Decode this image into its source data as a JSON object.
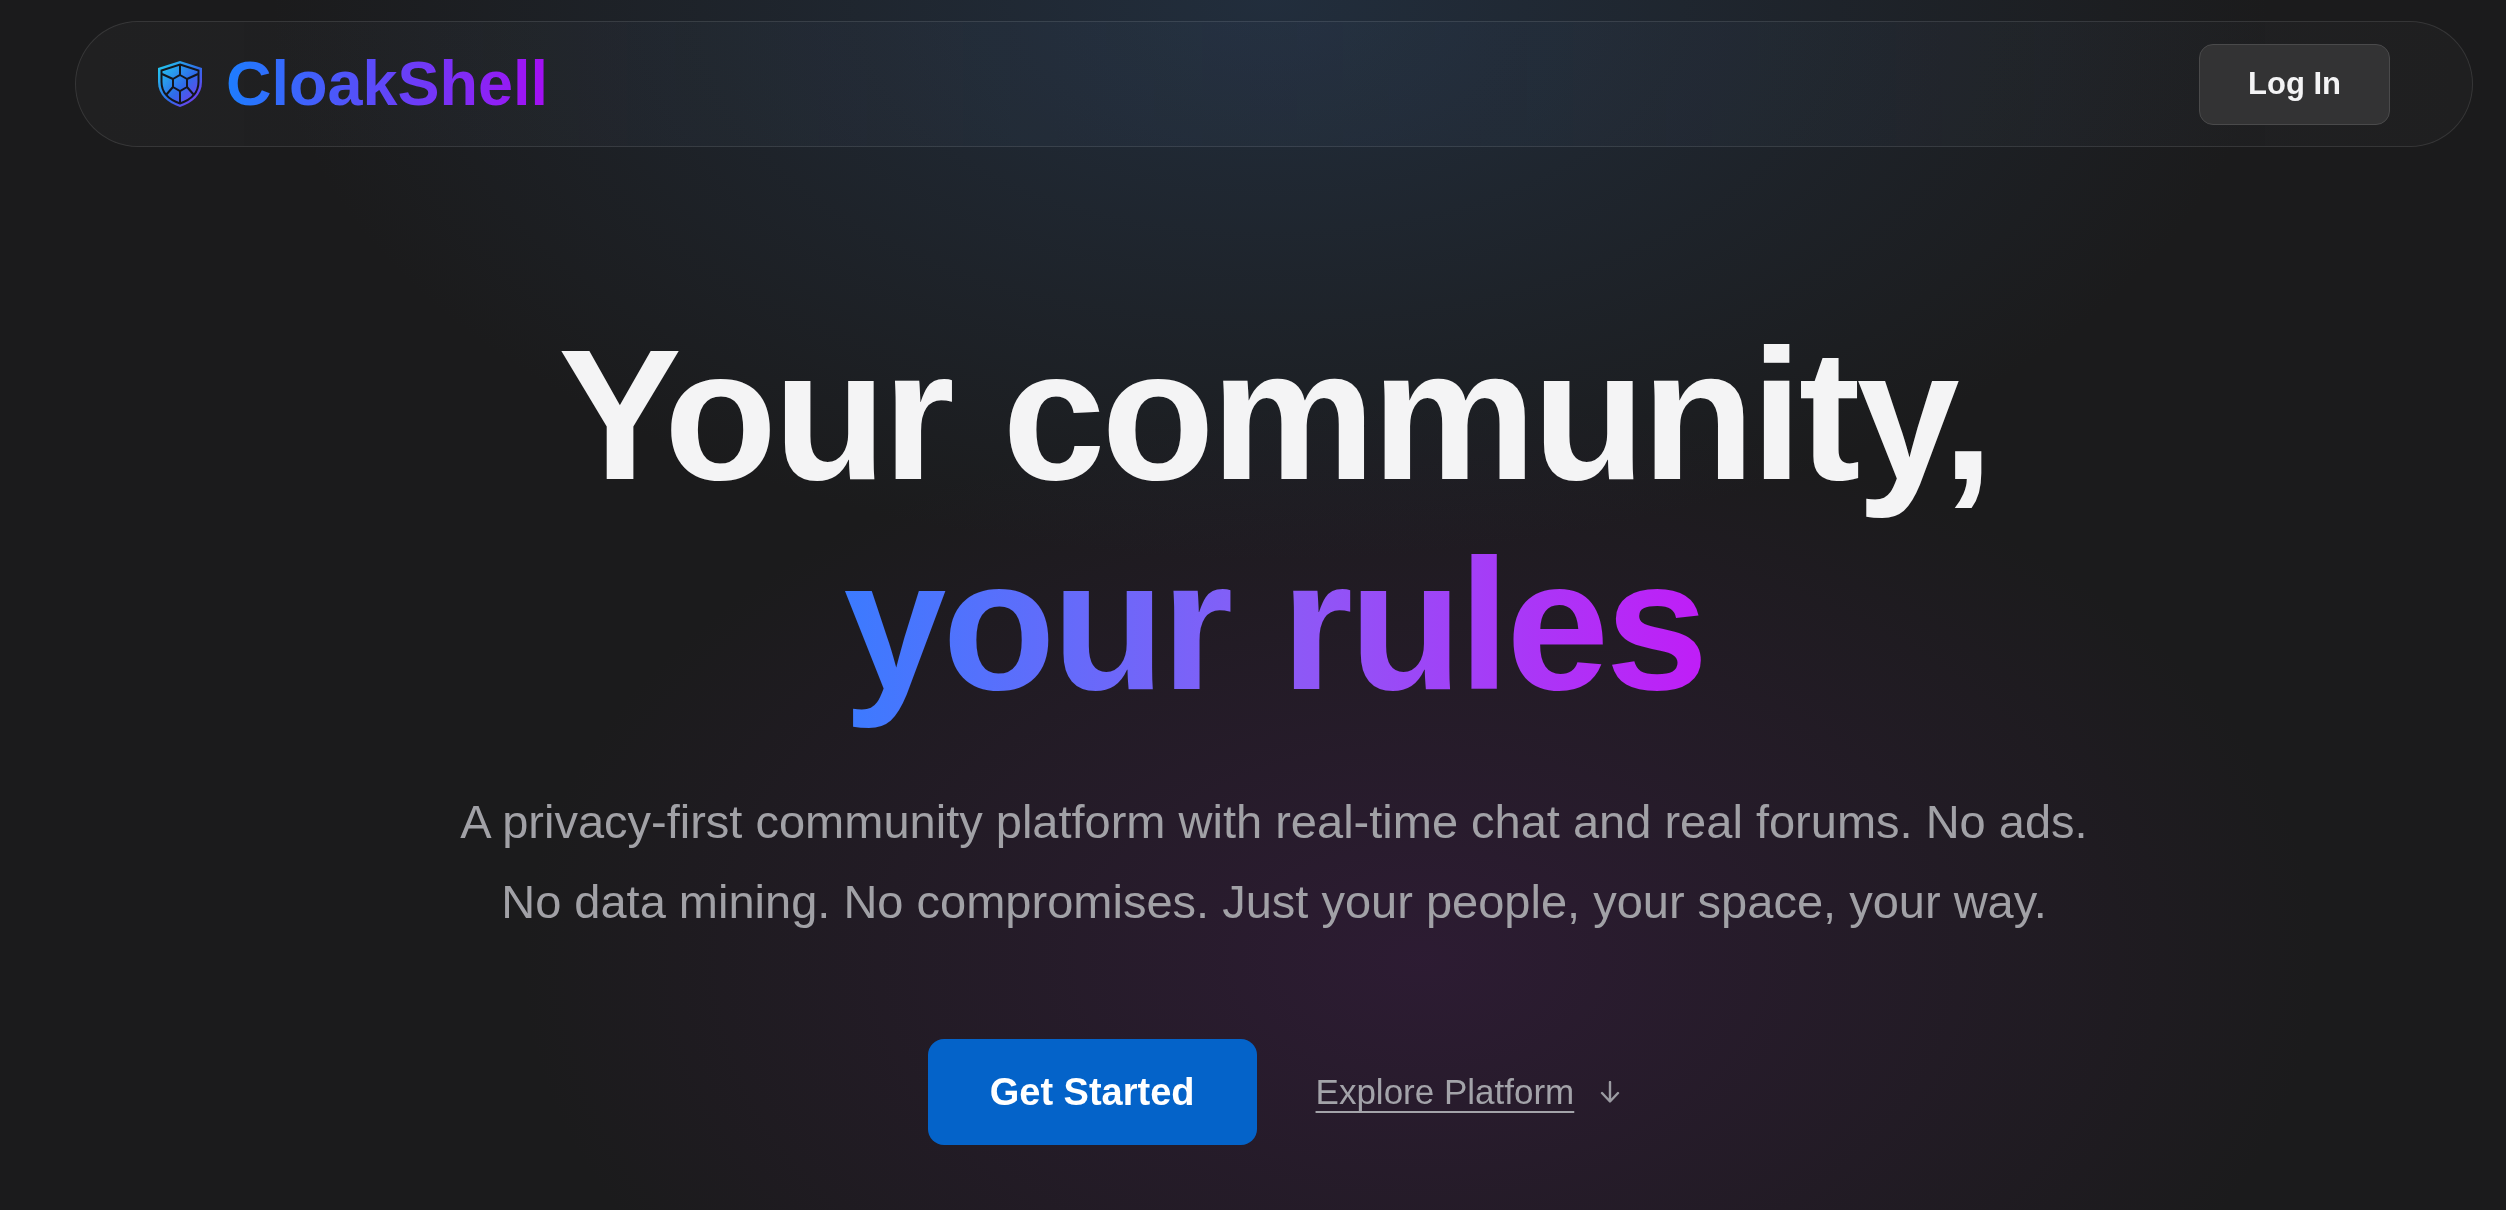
{
  "nav": {
    "brand": "CloakShell",
    "login_button": "Log In"
  },
  "hero": {
    "headline": "Your community,",
    "headline_highlight": "your rules",
    "subtitle": "A privacy-first community platform with real-time chat and real forums. No ads. No data mining. No compromises. Just your people, your space, your way.",
    "primary_button": "Get Started",
    "secondary_link": "Explore Platform"
  }
}
